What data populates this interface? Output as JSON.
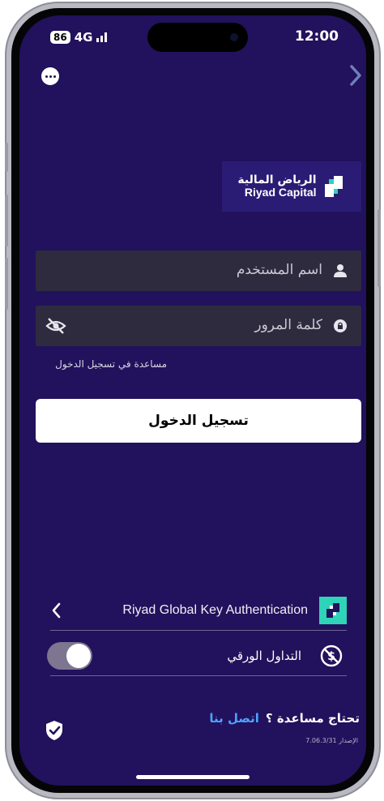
{
  "status_bar": {
    "battery": "86",
    "network": "4G",
    "time": "12:00"
  },
  "header": {
    "menu_icon": "more-dots-icon",
    "forward_icon": "chevron-right-icon"
  },
  "brand": {
    "name_ar": "الرياض المالية",
    "name_en": "Riyad Capital",
    "accent_color": "#2fd3b8"
  },
  "login_form": {
    "username_placeholder": "اسم المستخدم",
    "password_placeholder": "كلمة المرور",
    "help_link": "مساعدة في تسجيل الدخول",
    "submit_label": "تسجيل الدخول"
  },
  "options": {
    "rgk_label": "Riyad Global Key Authentication",
    "paper_trading_label": "التداول الورقي",
    "paper_trading_enabled": false
  },
  "footer": {
    "need_help": "تحتاج مساعدة ؟",
    "contact_us": "اتصل بنا",
    "version": "الإصدار 7.06.3/31",
    "link_color": "#4da3ff"
  },
  "colors": {
    "background": "#22115c",
    "field_background": "#2e2b3f"
  }
}
